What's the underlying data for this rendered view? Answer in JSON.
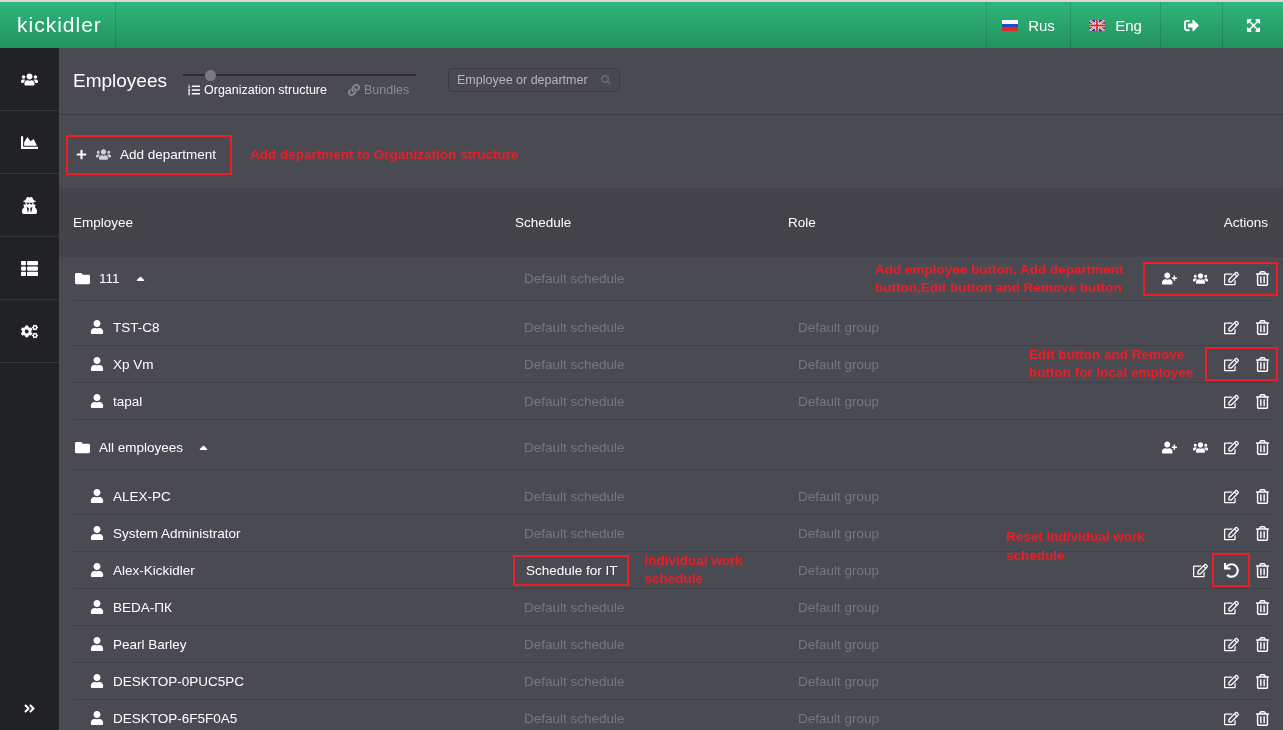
{
  "header": {
    "logo": "kickidler",
    "languages": [
      {
        "label": "Rus",
        "kind": "ru"
      },
      {
        "label": "Eng",
        "kind": "gb"
      }
    ]
  },
  "page": {
    "title": "Employees",
    "views": [
      {
        "label": "Organization structure",
        "kind": "list",
        "selected": true
      },
      {
        "label": "Bundles",
        "kind": "link",
        "selected": false
      }
    ],
    "search": {
      "placeholder": "Employee or departmer"
    }
  },
  "add_department": {
    "label": "Add department",
    "highlighted": true,
    "note": "Add department to Organization structure"
  },
  "table": {
    "columns": [
      "Employee",
      "Schedule",
      "Role",
      "Actions"
    ],
    "groups": [
      {
        "name": "111",
        "expanded": true,
        "schedule": "Default schedule",
        "actions": [
          {
            "kind": "add_employee",
            "highlighted": false
          },
          {
            "kind": "add_department",
            "highlighted": false
          },
          {
            "kind": "edit",
            "highlighted": false
          },
          {
            "kind": "remove",
            "highlighted": false
          }
        ],
        "actions_highlighted": true,
        "action_note": {
          "text": "Add employee button, Add department button,Edit button and Remove button",
          "kind": "beside"
        },
        "children": [
          {
            "name": "TST-C8",
            "schedule": {
              "text": "Default schedule",
              "individual": false,
              "highlighted": false
            },
            "role": "Default group",
            "actions": [
              {
                "kind": "edit",
                "highlighted": false
              },
              {
                "kind": "remove",
                "highlighted": false
              }
            ],
            "actions_highlighted": false
          },
          {
            "name": "Xp Vm",
            "schedule": {
              "text": "Default schedule",
              "individual": false,
              "highlighted": false
            },
            "role": "Default group",
            "actions": [
              {
                "kind": "edit",
                "highlighted": false
              },
              {
                "kind": "remove",
                "highlighted": false
              }
            ],
            "actions_highlighted": true,
            "action_note": {
              "text": "Edit button and Remove button for local employee",
              "kind": "beside"
            }
          },
          {
            "name": "tapal",
            "schedule": {
              "text": "Default schedule",
              "individual": false,
              "highlighted": false
            },
            "role": "Default group",
            "actions": [
              {
                "kind": "edit",
                "highlighted": false
              },
              {
                "kind": "remove",
                "highlighted": false
              }
            ],
            "actions_highlighted": false
          }
        ]
      },
      {
        "name": "All employees",
        "expanded": true,
        "schedule": "Default schedule",
        "actions": [
          {
            "kind": "add_employee",
            "highlighted": false
          },
          {
            "kind": "add_department",
            "highlighted": false
          },
          {
            "kind": "edit",
            "highlighted": false
          },
          {
            "kind": "remove",
            "highlighted": false
          }
        ],
        "actions_highlighted": false,
        "children": [
          {
            "name": "ALEX-PC",
            "schedule": {
              "text": "Default schedule",
              "individual": false,
              "highlighted": false
            },
            "role": "Default group",
            "actions": [
              {
                "kind": "edit",
                "highlighted": false
              },
              {
                "kind": "remove",
                "highlighted": false
              }
            ],
            "actions_highlighted": false
          },
          {
            "name": "System Administrator",
            "schedule": {
              "text": "Default schedule",
              "individual": false,
              "highlighted": false
            },
            "role": "Default group",
            "actions": [
              {
                "kind": "edit",
                "highlighted": false
              },
              {
                "kind": "remove",
                "highlighted": false
              }
            ],
            "actions_highlighted": false
          },
          {
            "name": "Alex-Kickidler",
            "schedule": {
              "text": "Schedule for IT",
              "individual": true,
              "highlighted": true,
              "note": "Individual work schedule"
            },
            "role": "Default group",
            "actions": [
              {
                "kind": "edit",
                "highlighted": false
              },
              {
                "kind": "reset",
                "highlighted": true
              },
              {
                "kind": "remove",
                "highlighted": false
              }
            ],
            "actions_highlighted": false,
            "action_note": {
              "text": "Reset individual work schedule",
              "kind": "above"
            }
          },
          {
            "name": "BEDA-ПК",
            "schedule": {
              "text": "Default schedule",
              "individual": false,
              "highlighted": false
            },
            "role": "Default group",
            "actions": [
              {
                "kind": "edit",
                "highlighted": false
              },
              {
                "kind": "remove",
                "highlighted": false
              }
            ],
            "actions_highlighted": false
          },
          {
            "name": "Pearl Barley",
            "schedule": {
              "text": "Default schedule",
              "individual": false,
              "highlighted": false
            },
            "role": "Default group",
            "actions": [
              {
                "kind": "edit",
                "highlighted": false
              },
              {
                "kind": "remove",
                "highlighted": false
              }
            ],
            "actions_highlighted": false
          },
          {
            "name": "DESKTOP-0PUC5PC",
            "schedule": {
              "text": "Default schedule",
              "individual": false,
              "highlighted": false
            },
            "role": "Default group",
            "actions": [
              {
                "kind": "edit",
                "highlighted": false
              },
              {
                "kind": "remove",
                "highlighted": false
              }
            ],
            "actions_highlighted": false
          },
          {
            "name": "DESKTOP-6F5F0A5",
            "schedule": {
              "text": "Default schedule",
              "individual": false,
              "highlighted": false
            },
            "role": "Default group",
            "actions": [
              {
                "kind": "edit",
                "highlighted": false
              },
              {
                "kind": "remove",
                "highlighted": false
              }
            ],
            "actions_highlighted": false
          }
        ]
      }
    ]
  }
}
